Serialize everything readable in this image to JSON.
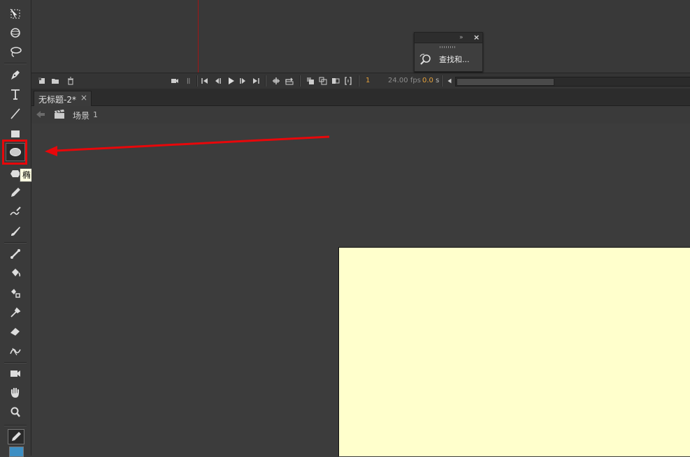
{
  "timeline": {
    "current_frame": "1",
    "fps_value": "24.00",
    "fps_unit": "fps",
    "time_value": "0.0",
    "time_unit": "s"
  },
  "find_panel": {
    "label": "查找和..."
  },
  "document": {
    "tab_title": "无标题-2*",
    "close_glyph": "×"
  },
  "scene": {
    "label": "场景",
    "number": "1"
  },
  "tooltip": {
    "text": "椭圆工具 (O)"
  },
  "colors": {
    "stage_bg": "#ffffcc",
    "highlight": "#e8070a",
    "playhead": "#a31515",
    "frame_number": "#e6a23c",
    "fill_swatch": "#3d8fc4"
  },
  "tools": [
    {
      "name": "selection-tool",
      "icon": "free-transform-icon"
    },
    {
      "name": "3d-rotation-tool",
      "icon": "3d-rotation-icon"
    },
    {
      "name": "lasso-tool",
      "icon": "lasso-icon"
    },
    {
      "name": "pen-tool",
      "icon": "pen-icon"
    },
    {
      "name": "text-tool",
      "icon": "text-icon"
    },
    {
      "name": "line-tool",
      "icon": "line-icon"
    },
    {
      "name": "rectangle-tool",
      "icon": "rectangle-icon"
    },
    {
      "name": "oval-tool",
      "icon": "ellipse-icon"
    },
    {
      "name": "polystar-tool",
      "icon": "polystar-icon"
    },
    {
      "name": "pencil-tool",
      "icon": "pencil-icon"
    },
    {
      "name": "brush-tool",
      "icon": "brush-icon"
    },
    {
      "name": "paint-brush-tool",
      "icon": "paint-brush-icon"
    },
    {
      "name": "bone-tool",
      "icon": "bone-icon"
    },
    {
      "name": "paint-bucket-tool",
      "icon": "paint-bucket-icon"
    },
    {
      "name": "ink-bottle-tool",
      "icon": "ink-bottle-icon"
    },
    {
      "name": "eyedropper-tool",
      "icon": "eyedropper-icon"
    },
    {
      "name": "eraser-tool",
      "icon": "eraser-icon"
    },
    {
      "name": "width-tool",
      "icon": "width-icon"
    },
    {
      "name": "camera-tool",
      "icon": "camera-icon"
    },
    {
      "name": "hand-tool",
      "icon": "hand-icon"
    },
    {
      "name": "zoom-tool",
      "icon": "zoom-icon"
    }
  ]
}
